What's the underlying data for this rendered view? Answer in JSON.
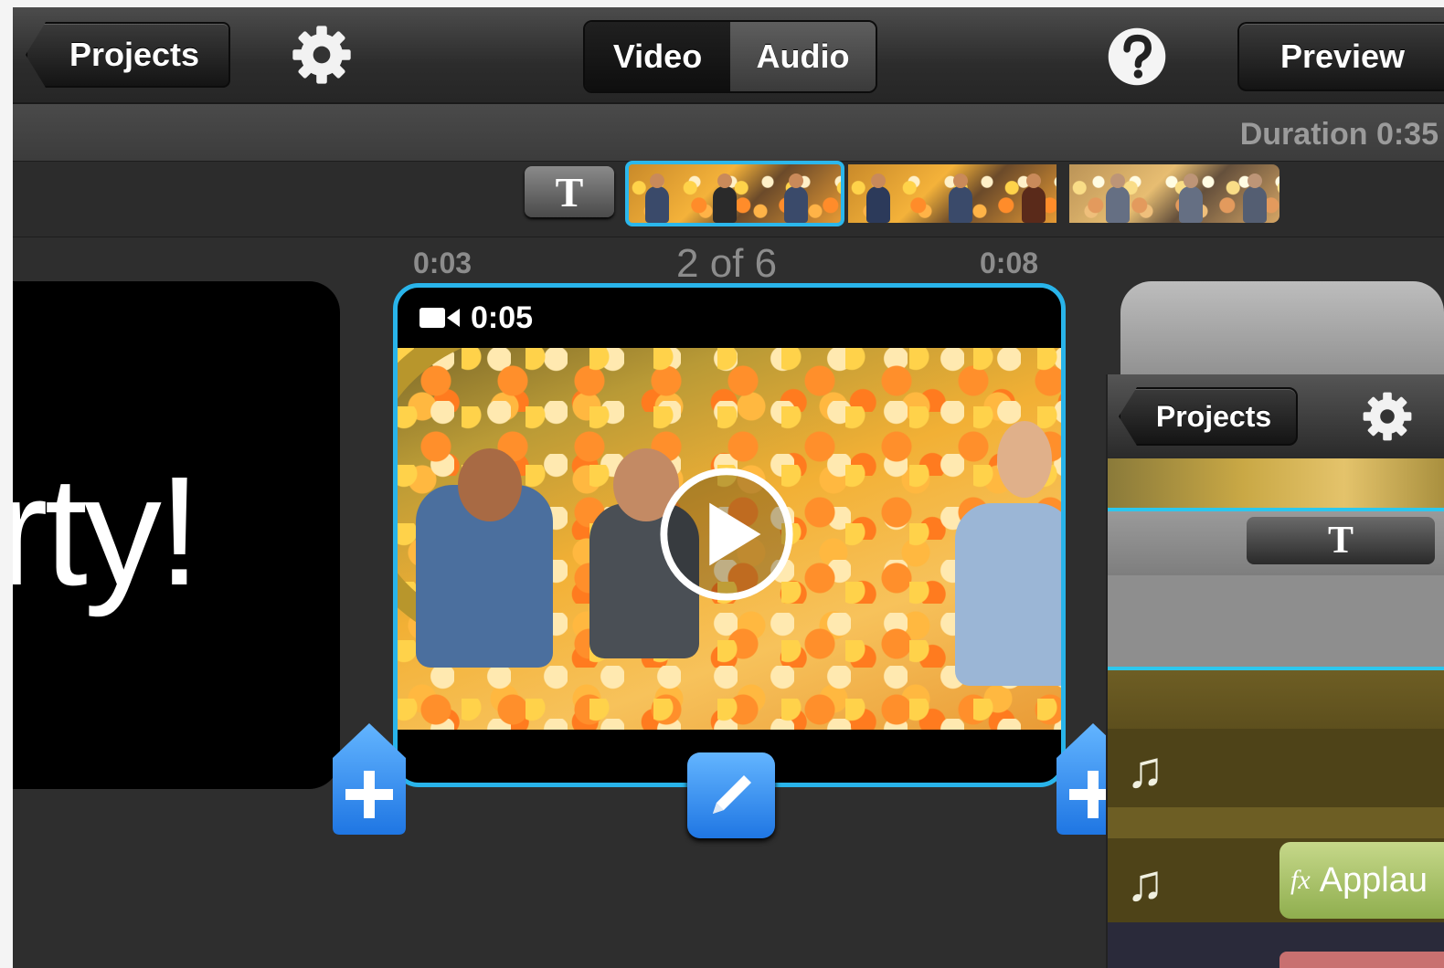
{
  "toolbar": {
    "back_label": "Projects",
    "segments": [
      "Video",
      "Audio"
    ],
    "preview_label": "Preview"
  },
  "duration": "Duration 0:35",
  "timeline": {
    "tick_left": "0:03",
    "counter": "2 of 6",
    "tick_right": "0:08",
    "title_chip": "T"
  },
  "left_card": {
    "text": "rty!"
  },
  "clip": {
    "duration": "0:05"
  },
  "inset": {
    "back_label": "Projects",
    "title_chip": "T",
    "audio_clip_label": "Applau",
    "fx_label": "fx"
  },
  "colors": {
    "accent": "#29b4ea",
    "button_blue": "#1f76e3"
  },
  "icons": [
    "gear-icon",
    "help-icon",
    "video-camera-icon",
    "play-icon",
    "add-icon",
    "pencil-icon",
    "music-note-icon"
  ]
}
